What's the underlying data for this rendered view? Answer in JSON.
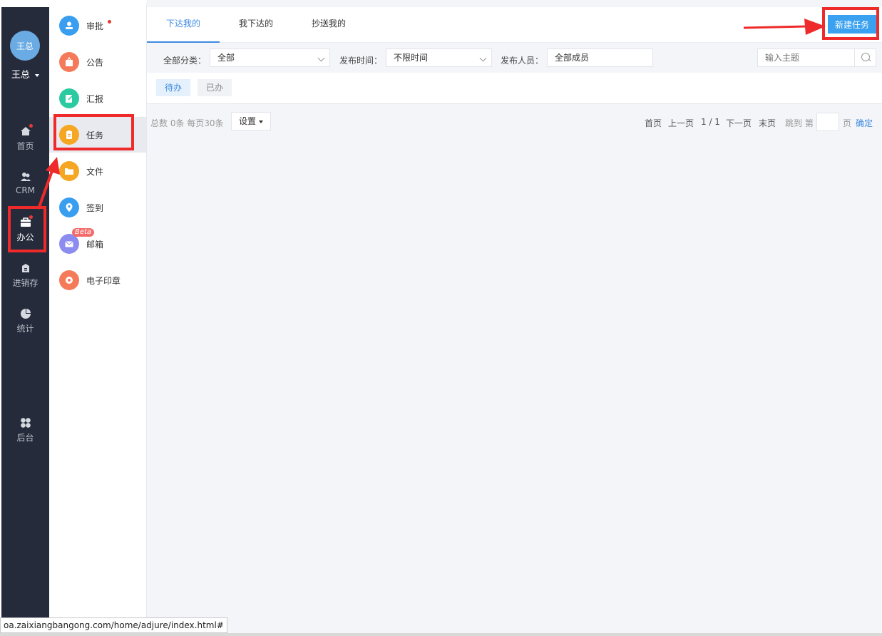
{
  "user": {
    "avatar_text": "王总",
    "name": "王总"
  },
  "rail": {
    "items": [
      {
        "label": "首页",
        "icon": "home-icon"
      },
      {
        "label": "CRM",
        "icon": "users-icon"
      },
      {
        "label": "办公",
        "icon": "briefcase-icon"
      },
      {
        "label": "进销存",
        "icon": "inventory-icon"
      },
      {
        "label": "统计",
        "icon": "pie-chart-icon"
      },
      {
        "label": "后台",
        "icon": "grid-icon"
      }
    ]
  },
  "menu": {
    "items": [
      {
        "label": "审批",
        "icon": "approval-icon",
        "color": "#3a9ef0"
      },
      {
        "label": "公告",
        "icon": "announcement-icon",
        "color": "#f47a5a"
      },
      {
        "label": "汇报",
        "icon": "report-icon",
        "color": "#2ccaa0"
      },
      {
        "label": "任务",
        "icon": "task-icon",
        "color": "#f5a623"
      },
      {
        "label": "文件",
        "icon": "folder-icon",
        "color": "#f5a623"
      },
      {
        "label": "签到",
        "icon": "location-icon",
        "color": "#3a9ef0"
      },
      {
        "label": "邮箱",
        "icon": "mail-icon",
        "color": "#8c8cf0",
        "badge": "Beta"
      },
      {
        "label": "电子印章",
        "icon": "seal-icon",
        "color": "#f47a5a"
      }
    ]
  },
  "tabs": [
    {
      "label": "下达我的"
    },
    {
      "label": "我下达的"
    },
    {
      "label": "抄送我的"
    }
  ],
  "new_task_label": "新建任务",
  "filters": {
    "category_label": "全部分类：",
    "category_value": "全部",
    "time_label": "发布时间：",
    "time_value": "不限时间",
    "publisher_label": "发布人员：",
    "publisher_value": "全部成员",
    "search_placeholder": "输入主题"
  },
  "subtabs": [
    {
      "label": "待办"
    },
    {
      "label": "已办"
    }
  ],
  "pager": {
    "summary": "总数 0条 每页30条",
    "settings_label": "设置",
    "first": "首页",
    "prev": "上一页",
    "page_info": "1 / 1",
    "next": "下一页",
    "last": "末页",
    "jump_label": "跳到 第",
    "page_unit": "页",
    "confirm": "确定"
  },
  "status_url": "oa.zaixiangbangong.com/home/adjure/index.html#",
  "colors": {
    "accent": "#3f8be0",
    "highlight": "#ee2a2a",
    "rail_bg": "#262b3b"
  }
}
